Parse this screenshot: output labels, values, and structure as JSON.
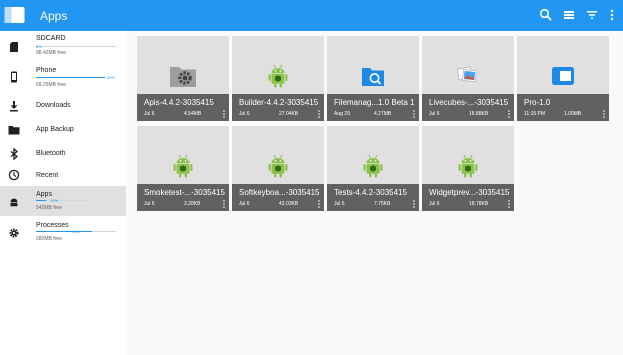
{
  "appbar": {
    "title": "Apps"
  },
  "sidebar": {
    "storage": [
      {
        "label": "SDCARD",
        "percent": "1%",
        "fill": 0.01,
        "free": "98.42MB free"
      },
      {
        "label": "Phone",
        "percent": "39%",
        "fill": 0.99,
        "free": "69.25MB free"
      }
    ],
    "nav": [
      {
        "label": "Downloads",
        "icon": "download-icon"
      },
      {
        "label": "App Backup",
        "icon": "folder-icon"
      },
      {
        "label": "Bluetooth",
        "icon": "bluetooth-icon"
      },
      {
        "label": "Recent",
        "icon": "history-icon"
      }
    ],
    "apps": {
      "label": "Apps",
      "percent": "10%",
      "fill": 0.1,
      "free": "542MB free"
    },
    "processes": {
      "label": "Processes",
      "percent": "44%",
      "fill": 0.7,
      "free": "280MB free"
    }
  },
  "tiles": [
    {
      "name": "Apis-4.4.2-3035415",
      "date": "Jul 6",
      "size": "4.54MB",
      "icon": "settings-app-icon"
    },
    {
      "name": "Builder-4.4.2-3035415",
      "date": "Jul 6",
      "size": "27.04KB",
      "icon": "android-icon"
    },
    {
      "name": "Filemanag...1.0 Beta 1",
      "date": "Aug 29",
      "size": "4.27MB",
      "icon": "file-manager-icon"
    },
    {
      "name": "Livecubes-...-3035415",
      "date": "Jul 6",
      "size": "18.88KB",
      "icon": "photos-icon"
    },
    {
      "name": "Pro-1.0",
      "date": "11:15 PM",
      "size": "1.09MB",
      "icon": "folder-app-icon"
    },
    {
      "name": "Smoketest-...-3035415",
      "date": "Jul 6",
      "size": "3.28KB",
      "icon": "android-icon"
    },
    {
      "name": "Softkeyboa...-3035415",
      "date": "Jul 6",
      "size": "43.03KB",
      "icon": "android-icon"
    },
    {
      "name": "Tests-4.4.2-3035415",
      "date": "Jul 6",
      "size": "7.75KB",
      "icon": "android-icon"
    },
    {
      "name": "Widgetprev...-3035415",
      "date": "Jul 6",
      "size": "18.78KB",
      "icon": "android-icon"
    }
  ]
}
